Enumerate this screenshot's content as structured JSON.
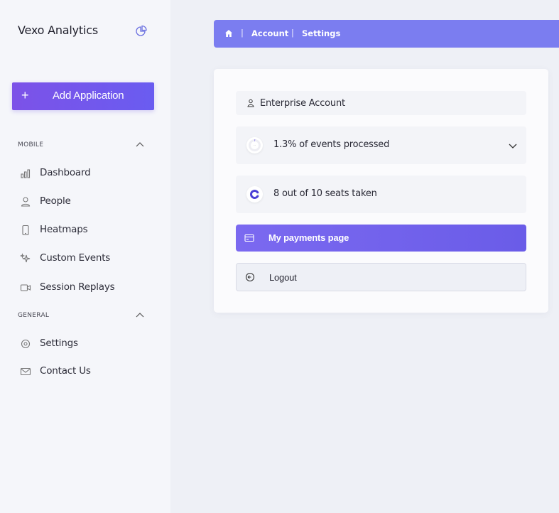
{
  "app": {
    "name": "Vexo Analytics"
  },
  "sidebar": {
    "add_button_label": "Add Application",
    "add_button_symbol": "+",
    "sections": [
      {
        "title": "MOBILE",
        "items": [
          {
            "label": "Dashboard",
            "icon": "bar-chart-icon"
          },
          {
            "label": "People",
            "icon": "user-icon"
          },
          {
            "label": "Heatmaps",
            "icon": "phone-icon"
          },
          {
            "label": "Custom Events",
            "icon": "sparkles-icon"
          },
          {
            "label": "Session Replays",
            "icon": "video-icon"
          }
        ]
      },
      {
        "title": "GENERAL",
        "items": [
          {
            "label": "Settings",
            "icon": "gear-icon"
          },
          {
            "label": "Contact Us",
            "icon": "mail-icon"
          }
        ]
      }
    ]
  },
  "breadcrumb": {
    "separator": "|",
    "items": [
      "Account",
      "Settings"
    ]
  },
  "account_card": {
    "account_name": "Enterprise Account",
    "events_text": "1.3% of events processed",
    "events_percent": 1.3,
    "seats_text": "8 out of 10 seats taken",
    "seats_fraction": 0.8,
    "payments_label": "My payments page",
    "logout_label": "Logout"
  },
  "colors": {
    "accent": "#6c5ce7",
    "breadcrumb_bg": "#7b7df0",
    "sidebar_bg": "#f5f6fa"
  }
}
